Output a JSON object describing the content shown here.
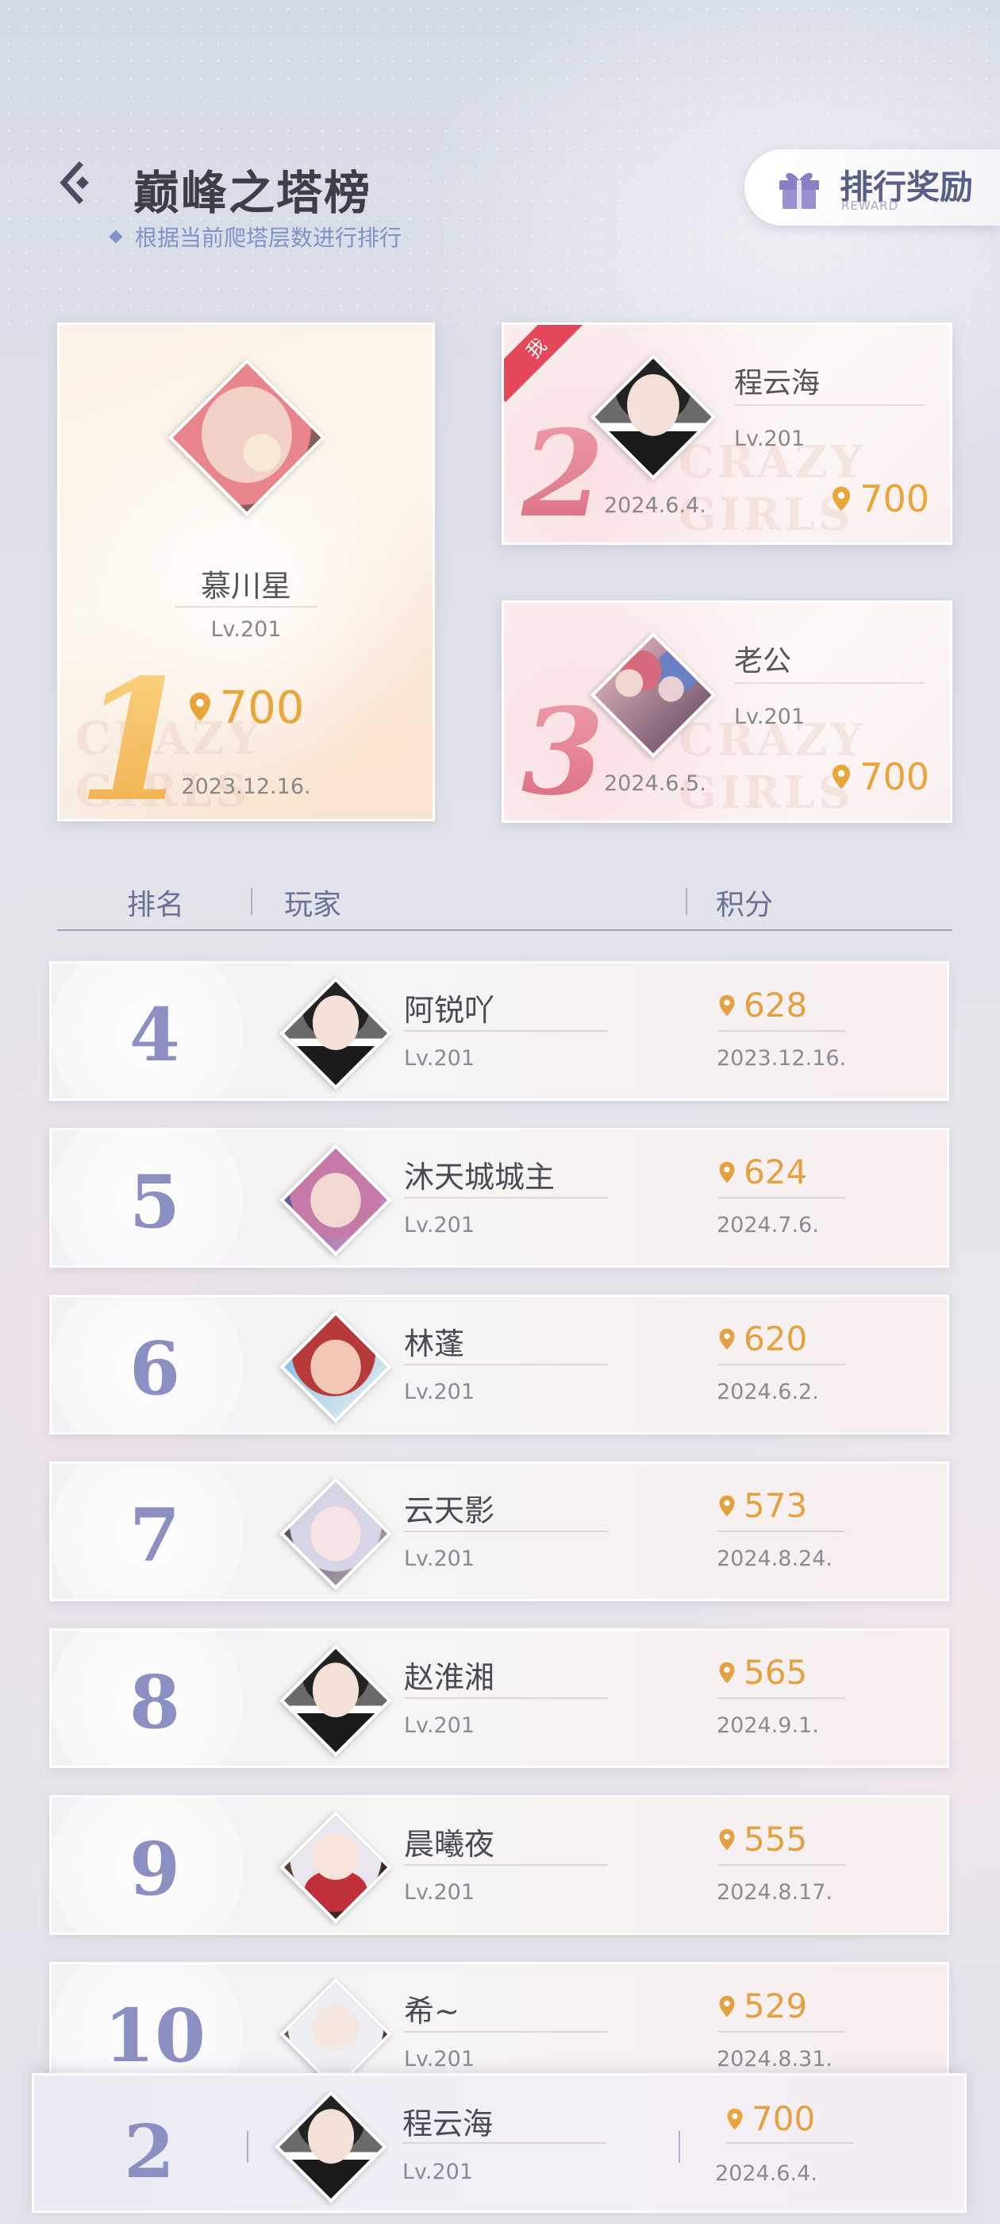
{
  "header": {
    "title": "巅峰之塔榜",
    "subtitle": "根据当前爬塔层数进行排行",
    "reward_label": "排行奖励",
    "reward_sub": "REWARD"
  },
  "top3": [
    {
      "rank": "1",
      "name": "慕川星",
      "level": "Lv.201",
      "score": "700",
      "date": "2023.12.16.",
      "avatar": "pink-hair-girl-avatar"
    },
    {
      "rank": "2",
      "name": "程云海",
      "level": "Lv.201",
      "score": "700",
      "date": "2024.6.4.",
      "avatar": "man-in-suit-avatar",
      "me_tag": "我"
    },
    {
      "rank": "3",
      "name": "老公",
      "level": "Lv.201",
      "score": "700",
      "date": "2024.6.5.",
      "avatar": "group-girls-avatar"
    }
  ],
  "watermark": "CRAZY GIRLS",
  "list_header": {
    "rank": "排名",
    "player": "玩家",
    "score": "积分"
  },
  "rows": [
    {
      "rank": "4",
      "name": "阿锐吖",
      "level": "Lv.201",
      "score": "628",
      "date": "2023.12.16."
    },
    {
      "rank": "5",
      "name": "沐天城城主",
      "level": "Lv.201",
      "score": "624",
      "date": "2024.7.6."
    },
    {
      "rank": "6",
      "name": "林蓬",
      "level": "Lv.201",
      "score": "620",
      "date": "2024.6.2."
    },
    {
      "rank": "7",
      "name": "云天影",
      "level": "Lv.201",
      "score": "573",
      "date": "2024.8.24."
    },
    {
      "rank": "8",
      "name": "赵淮湘",
      "level": "Lv.201",
      "score": "565",
      "date": "2024.9.1."
    },
    {
      "rank": "9",
      "name": "晨曦夜",
      "level": "Lv.201",
      "score": "555",
      "date": "2024.8.17."
    },
    {
      "rank": "10",
      "name": "希~",
      "level": "Lv.201",
      "score": "529",
      "date": "2024.8.31."
    }
  ],
  "my_row": {
    "rank": "2",
    "name": "程云海",
    "level": "Lv.201",
    "score": "700",
    "date": "2024.6.4."
  },
  "colors": {
    "accent_gold": "#e8a53a",
    "rank_purple": "#8c8fc2",
    "title_blue": "#7f93c9",
    "me_red": "#e3485a"
  }
}
